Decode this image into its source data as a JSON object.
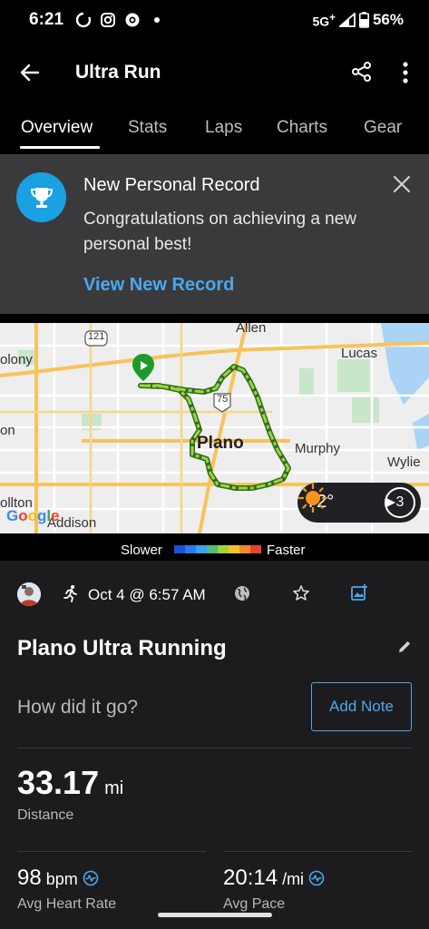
{
  "status_bar": {
    "time": "6:21",
    "network": "5G",
    "network_plus": "+",
    "battery": "56%"
  },
  "app_bar": {
    "title": "Ultra Run",
    "back_icon": "arrow-left-icon",
    "share_icon": "share-icon",
    "more_icon": "more-vert-icon"
  },
  "tabs": [
    {
      "label": "Overview",
      "active": true
    },
    {
      "label": "Stats",
      "active": false
    },
    {
      "label": "Laps",
      "active": false
    },
    {
      "label": "Charts",
      "active": false
    },
    {
      "label": "Gear",
      "active": false
    }
  ],
  "banner": {
    "title": "New Personal Record",
    "text": "Congratulations on achieving a new personal best!",
    "link": "View New Record",
    "icon": "trophy-icon"
  },
  "map": {
    "labels": {
      "allen": "Allen",
      "lucas": "Lucas",
      "colony": "olony",
      "on": "on",
      "plano": "Plano",
      "murphy": "Murphy",
      "wylie": "Wylie",
      "carrollton": "ollton",
      "addison": "Addison",
      "hwy121": "121",
      "hwy75": "75"
    },
    "google": "Google",
    "weather": {
      "temp": "72°",
      "wind": "3"
    }
  },
  "pace_legend": {
    "slower": "Slower",
    "faster": "Faster",
    "colors": [
      "#1e4fd6",
      "#2b7bea",
      "#3aa0f0",
      "#4cc07a",
      "#9fd33a",
      "#f2c12e",
      "#f08a2a",
      "#e4452b"
    ]
  },
  "activity": {
    "date": "Oct 4 @ 6:57 AM",
    "title": "Plano Ultra Running",
    "note_prompt": "How did it go?",
    "add_note": "Add Note"
  },
  "stats": {
    "distance": {
      "value": "33.17",
      "unit": "mi",
      "label": "Distance"
    },
    "heart_rate": {
      "value": "98",
      "unit": "bpm",
      "label": "Avg Heart Rate"
    },
    "pace": {
      "value": "20:14",
      "unit": "/mi",
      "label": "Avg Pace"
    }
  },
  "colors": {
    "accent": "#4ba8ee",
    "banner_bg": "#3a3a3c",
    "trophy_bg": "#1aa1e2",
    "content_bg": "#1c1c1e"
  }
}
